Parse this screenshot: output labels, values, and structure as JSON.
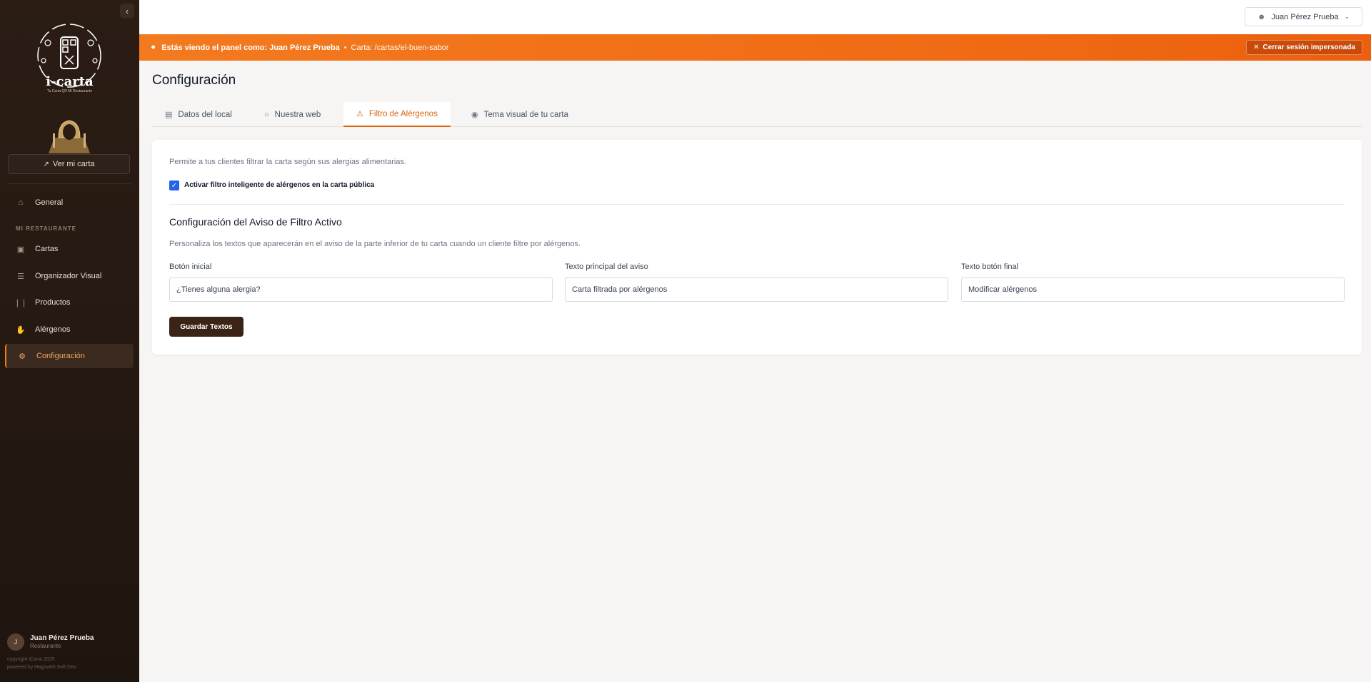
{
  "sidebar": {
    "collapse_icon": "chevron-left-icon",
    "logo": {
      "title": "i-carta",
      "subtitle": "Tu Carta QR Mi Restaurante"
    },
    "view_menu_label": "Ver mi carta",
    "section_title": "MI RESTAURANTE",
    "items": [
      {
        "label": "General",
        "icon": "home-icon"
      },
      {
        "label": "Cartas",
        "icon": "book-icon"
      },
      {
        "label": "Organizador Visual",
        "icon": "layers-icon"
      },
      {
        "label": "Productos",
        "icon": "utensils-icon"
      },
      {
        "label": "Alérgenos",
        "icon": "hand-icon"
      },
      {
        "label": "Configuración",
        "icon": "cogs-icon",
        "active": true
      }
    ],
    "user": {
      "initial": "J",
      "name": "Juan Pérez Prueba",
      "role": "Restaurante"
    },
    "copyright": "copyright iCarta 2025",
    "powered": "powered by Hagoweb Soft Dev"
  },
  "topbar": {
    "user_name": "Juan Pérez Prueba"
  },
  "banner": {
    "prefix": "Estás viendo el panel como:",
    "user": "Juan Pérez Prueba",
    "sep": "•",
    "carta": "Carta: /cartas/el-buen-sabor",
    "end_button": "Cerrar sesión impersonada"
  },
  "page": {
    "title": "Configuración",
    "tabs": [
      {
        "label": "Datos del local",
        "icon": "store-icon"
      },
      {
        "label": "Nuestra web",
        "icon": "globe-icon"
      },
      {
        "label": "Filtro de Alérgenos",
        "icon": "warning-icon",
        "active": true
      },
      {
        "label": "Tema visual de tu carta",
        "icon": "palette-icon"
      }
    ]
  },
  "allergen_filter": {
    "intro": "Permite a tus clientes filtrar la carta según sus alergias alimentarias.",
    "checkbox_label": "Activar filtro inteligente de alérgenos en la carta pública",
    "checkbox_checked": true,
    "section_title": "Configuración del Aviso de Filtro Activo",
    "section_desc": "Personaliza los textos que aparecerán en el aviso de la parte inferior de tu carta cuando un cliente filtre por alérgenos.",
    "fields": [
      {
        "label": "Botón inicial",
        "value": "¿Tienes alguna alergia?"
      },
      {
        "label": "Texto principal del aviso",
        "value": "Carta filtrada por alérgenos"
      },
      {
        "label": "Texto botón final",
        "value": "Modificar alérgenos"
      }
    ],
    "save_button": "Guardar Textos"
  },
  "colors": {
    "accent": "#f07a1e",
    "sidebar_bg": "#2b1d14",
    "checkbox": "#2563eb",
    "save_button": "#3b2416"
  }
}
